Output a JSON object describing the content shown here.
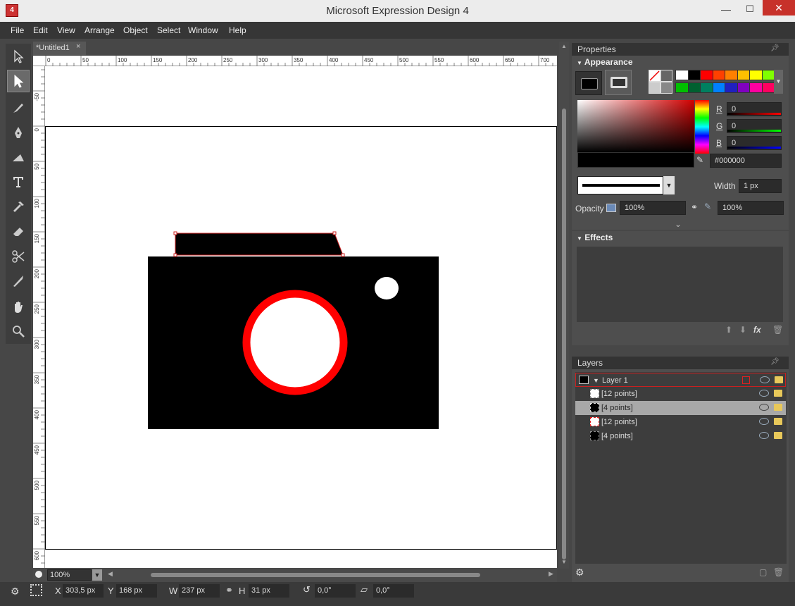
{
  "window": {
    "title": "Microsoft Expression Design 4",
    "app_icon_text": "4",
    "minimize": "—",
    "maximize": "☐",
    "close": "✕"
  },
  "menu": [
    "File",
    "Edit",
    "View",
    "Arrange",
    "Object",
    "Select",
    "Window",
    "Help"
  ],
  "document": {
    "tab_label": "*Untitled1",
    "tab_close": "×",
    "ruler_unit": "Px",
    "ruler_h_ticks": [
      "0",
      "50",
      "100",
      "150",
      "200",
      "250",
      "300",
      "350",
      "400",
      "450",
      "500",
      "550",
      "600",
      "650",
      "700"
    ],
    "ruler_v_ticks": [
      "-50",
      "0",
      "50",
      "100",
      "150",
      "200",
      "250",
      "300",
      "350",
      "400",
      "450",
      "500",
      "550",
      "600"
    ]
  },
  "canvas": {
    "zoom": "100%"
  },
  "status": {
    "x_label": "X",
    "x_value": "303,5 px",
    "y_label": "Y",
    "y_value": "168 px",
    "w_label": "W",
    "w_value": "237 px",
    "h_label": "H",
    "h_value": "31 px",
    "rotation": "0,0°",
    "skew": "0,0°"
  },
  "properties": {
    "panel_title": "Properties",
    "appearance_title": "Appearance",
    "swatch_colors": [
      "#ffffff",
      "#000000",
      "#ff0000",
      "#ff4000",
      "#ff8000",
      "#ffc000",
      "#ffff00",
      "#80ff00",
      "#00c000",
      "#006030",
      "#008060",
      "#0080ff",
      "#2020c0",
      "#8000c0",
      "#ff00a0",
      "#ff0060"
    ],
    "r_label": "R",
    "r_value": "0",
    "g_label": "G",
    "g_value": "0",
    "b_label": "B",
    "b_value": "0",
    "hex_value": "#000000",
    "width_label": "Width",
    "width_value": "1 px",
    "opacity_label": "Opacity",
    "opacity_value": "100%",
    "opacity2_value": "100%",
    "effects_title": "Effects",
    "fx_label": "fx"
  },
  "layers": {
    "panel_title": "Layers",
    "layer_name": "Layer 1",
    "items": [
      "[12 points]",
      "[4 points]",
      "[12 points]",
      "[4 points]"
    ]
  },
  "colors": {
    "accent_red": "#ff0000",
    "selection_red": "#c82020",
    "panel_bg": "#4e4e4e",
    "app_bg": "#474747"
  }
}
